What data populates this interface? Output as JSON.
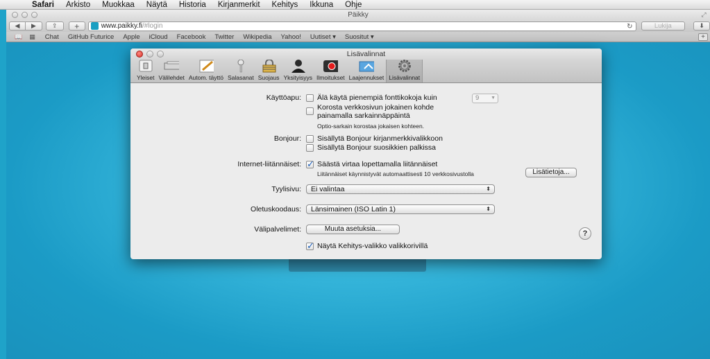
{
  "menubar": {
    "apple_glyph": "",
    "items": [
      "Safari",
      "Arkisto",
      "Muokkaa",
      "Näytä",
      "Historia",
      "Kirjanmerkit",
      "Kehitys",
      "Ikkuna",
      "Ohje"
    ]
  },
  "browser": {
    "window_title": "Päikky",
    "url_host": "www.paikky.fi",
    "url_path": "/#login",
    "reader_label": "Lukija",
    "bookmarks": [
      "Chat",
      "GitHub Futurice",
      "Apple",
      "iCloud",
      "Facebook",
      "Twitter",
      "Wikipedia",
      "Yahoo!",
      "Uutiset ▾",
      "Suositut ▾"
    ]
  },
  "dialog": {
    "title": "Lisävalinnat",
    "tabs": [
      {
        "label": "Yleiset",
        "icon": "switch-icon"
      },
      {
        "label": "Välilehdet",
        "icon": "tabs-icon"
      },
      {
        "label": "Autom. täyttö",
        "icon": "pencil-icon"
      },
      {
        "label": "Salasanat",
        "icon": "key-icon"
      },
      {
        "label": "Suojaus",
        "icon": "lock-icon"
      },
      {
        "label": "Yksityisyys",
        "icon": "person-icon"
      },
      {
        "label": "Ilmoitukset",
        "icon": "notification-icon"
      },
      {
        "label": "Laajennukset",
        "icon": "extension-icon"
      },
      {
        "label": "Lisävalinnat",
        "icon": "gear-icon"
      }
    ],
    "active_tab": "Lisävalinnat",
    "accessibility": {
      "label": "Käyttöapu:",
      "min_font_option": "Älä käytä pienempiä fonttikokoja kuin",
      "min_font_value": "9",
      "highlight_option_line1": "Korosta verkkosivun jokainen kohde",
      "highlight_option_line2": "painamalla sarkainnäppäintä",
      "highlight_hint": "Optio-sarkain korostaa jokaisen kohteen."
    },
    "bonjour": {
      "label": "Bonjour:",
      "option1": "Sisällytä Bonjour kirjanmerkkivalikkoon",
      "option2": "Sisällytä Bonjour suosikkien palkissa"
    },
    "plugins": {
      "label": "Internet-liitännäiset:",
      "option": "Säästä virtaa lopettamalla liitännäiset",
      "checked": true,
      "hint": "Liitännäiset käynnistyvät automaattisesti 10 verkkosivustolla",
      "more_button": "Lisätietoja..."
    },
    "stylesheet": {
      "label": "Tyylisivu:",
      "value": "Ei valintaa"
    },
    "encoding": {
      "label": "Oletuskoodaus:",
      "value": "Länsimainen (ISO Latin 1)"
    },
    "proxies": {
      "label": "Välipalvelimet:",
      "button": "Muuta asetuksia..."
    },
    "develop_menu": {
      "option": "Näytä Kehitys-valikko valikkorivillä",
      "checked": true
    },
    "help_glyph": "?"
  }
}
